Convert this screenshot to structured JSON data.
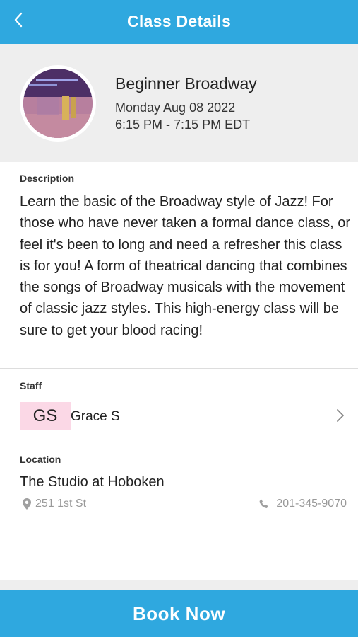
{
  "header": {
    "title": "Class Details",
    "back_icon": "chevron-left-icon"
  },
  "class": {
    "name": "Beginner Broadway",
    "date": "Monday Aug 08 2022",
    "time": "6:15 PM - 7:15 PM EDT",
    "image": "studio-photo"
  },
  "description": {
    "label": "Description",
    "text": "Learn the basic of the Broadway style of Jazz! For those who have never taken a formal dance class, or feel it's been to long and need a refresher this class is for you! A form of theatrical dancing that combines the songs of Broadway musicals with the movement of classic jazz styles. This high-energy class will be sure to get your blood racing!"
  },
  "staff": {
    "label": "Staff",
    "initials": "GS",
    "name": "Grace S",
    "initials_bg": "#fbd8e6"
  },
  "location": {
    "label": "Location",
    "name": "The Studio at Hoboken",
    "address": "251 1st St",
    "phone": "201-345-9070",
    "address_icon": "map-pin-icon",
    "phone_icon": "phone-icon"
  },
  "footer": {
    "book_label": "Book Now"
  },
  "colors": {
    "accent": "#2fa8df",
    "panel": "#eeeeee",
    "muted": "#999999"
  }
}
